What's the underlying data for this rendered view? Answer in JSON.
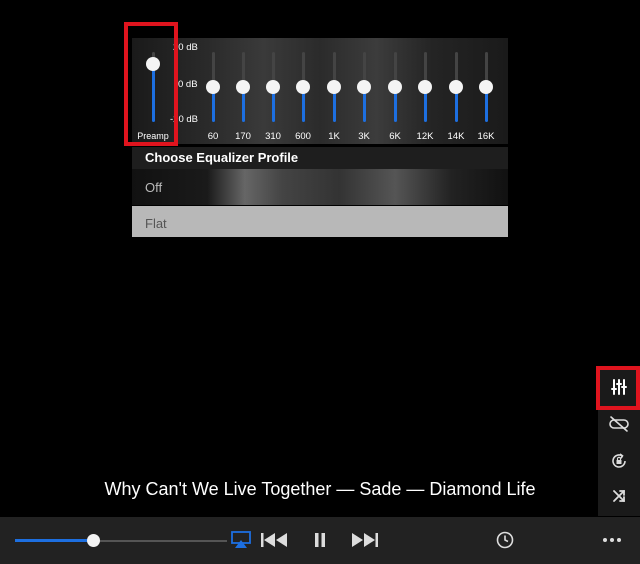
{
  "equalizer": {
    "db_labels": {
      "top": "20 dB",
      "mid": "0 dB",
      "bottom": "-20 dB"
    },
    "preamp": {
      "label": "Preamp",
      "level": 0.83
    },
    "bands": [
      {
        "label": "60",
        "level": 0.5
      },
      {
        "label": "170",
        "level": 0.5
      },
      {
        "label": "310",
        "level": 0.5
      },
      {
        "label": "600",
        "level": 0.5
      },
      {
        "label": "1K",
        "level": 0.5
      },
      {
        "label": "3K",
        "level": 0.5
      },
      {
        "label": "6K",
        "level": 0.5
      },
      {
        "label": "12K",
        "level": 0.5
      },
      {
        "label": "14K",
        "level": 0.5
      },
      {
        "label": "16K",
        "level": 0.5
      }
    ]
  },
  "profiles": {
    "title": "Choose Equalizer Profile",
    "items": [
      "Off",
      "Flat"
    ]
  },
  "side_tools": [
    "equalizer-icon",
    "no-repeat-icon",
    "rotation-lock-icon",
    "shuffle-icon"
  ],
  "now_playing": {
    "title": "Why Can't We Live Together — Sade — Diamond Life",
    "progress": 0.37
  },
  "colors": {
    "accent": "#1d6fe0",
    "highlight": "#e0141e"
  }
}
